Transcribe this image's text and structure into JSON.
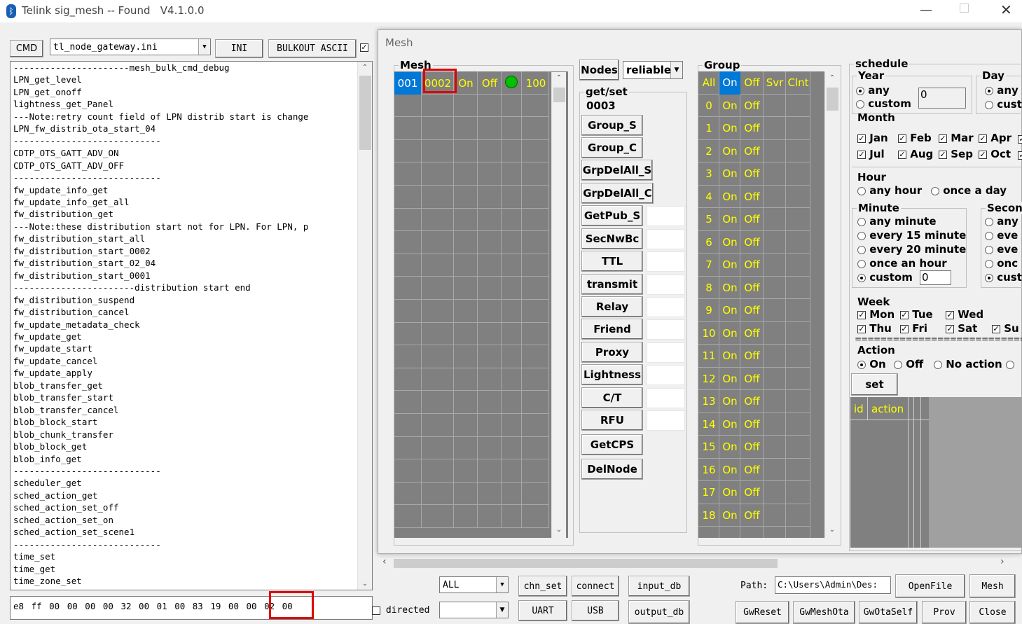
{
  "window": {
    "title": "Telink sig_mesh -- Found   V4.1.0.0"
  },
  "toolbar": {
    "cmd": "CMD",
    "ini_file": "tl_node_gateway.ini",
    "ini": "INI",
    "bulkout": "BULKOUT ASCII"
  },
  "cmd_list": [
    "----------------------mesh_bulk_cmd_debug",
    "LPN_get_level",
    "LPN_get_onoff",
    "lightness_get_Panel",
    "---Note:retry count field of LPN distrib start is change",
    "LPN_fw_distrib_ota_start_04",
    "----------------------------",
    "CDTP_OTS_GATT_ADV_ON",
    "CDTP_OTS_GATT_ADV_OFF",
    "----------------------------",
    "fw_update_info_get",
    "fw_update_info_get_all",
    "fw_distribution_get",
    "---Note:these distribution start not for LPN. For LPN, p",
    "fw_distribution_start_all",
    "fw_distribution_start_0002",
    "fw_distribution_start_02_04",
    "fw_distribution_start_0001",
    "-----------------------distribution start end",
    "fw_distribution_suspend",
    "fw_distribution_cancel",
    "fw_update_metadata_check",
    "fw_update_get",
    "fw_update_start",
    "fw_update_cancel",
    "fw_update_apply",
    "blob_transfer_get",
    "blob_transfer_start",
    "blob_transfer_cancel",
    "blob_block_start",
    "blob_chunk_transfer",
    "blob_block_get",
    "blob_info_get",
    "----------------------------",
    "scheduler_get",
    "sched_action_get",
    "sched_action_set_off",
    "sched_action_set_on",
    "sched_action_set_scene1",
    "----------------------------",
    "time_set",
    "time_get",
    "time_zone_set"
  ],
  "cmd_input": {
    "value": "e8 ff 00 00 00 00 32 00 01 00 83 19 00 00 02 00"
  },
  "bottom": {
    "all": "ALL",
    "directed": "directed",
    "chn_set": "chn_set",
    "connect": "connect",
    "input_db": "input_db",
    "uart": "UART",
    "usb": "USB",
    "output_db": "output_db",
    "path_label": "Path:",
    "path_value": "C:\\Users\\Admin\\Des:",
    "openfile": "OpenFile",
    "mesh": "Mesh",
    "gwreset": "GwReset",
    "gwmeshota": "GwMeshOta",
    "gwotaself": "GwOtaSelf",
    "prov": "Prov",
    "close": "Close"
  },
  "mesh_dialog": {
    "title": "Mesh",
    "mesh_label": "Mesh",
    "node": {
      "index": "001",
      "addr": "0002",
      "on": "On",
      "off": "Off",
      "level": "100",
      "status_color": "#00c000"
    },
    "nodes_label": "Nodes",
    "nodes_mode": "reliable",
    "getset_label": "get/set",
    "getset_addr": "0003",
    "buttons": [
      "Group_S",
      "Group_C",
      "GrpDelAll_S",
      "GrpDelAll_C",
      "GetPub_S",
      "SecNwBc",
      "TTL",
      "transmit",
      "Relay",
      "Friend",
      "Proxy",
      "Lightness",
      "C/T",
      "RFU",
      "GetCPS",
      "DelNode"
    ],
    "group_label": "Group",
    "group_header": [
      "All",
      "On",
      "Off",
      "Svr",
      "Clnt"
    ],
    "group_rows": [
      "0",
      "1",
      "2",
      "3",
      "4",
      "5",
      "6",
      "7",
      "8",
      "9",
      "10",
      "11",
      "12",
      "13",
      "14",
      "15",
      "16",
      "17",
      "18"
    ],
    "on": "On",
    "off": "Off",
    "schedule": {
      "title": "schedule",
      "year": "Year",
      "any": "any",
      "custom": "custom",
      "year_value": "0",
      "day": "Day",
      "day_any": "any",
      "day_custom": "cust",
      "month": "Month",
      "months": [
        "Jan",
        "Feb",
        "Mar",
        "Apr",
        "Jul",
        "Aug",
        "Sep",
        "Oct"
      ],
      "hour": "Hour",
      "any_hour": "any hour",
      "once_a_day": "once a day",
      "minute": "Minute",
      "any_minute": "any minute",
      "every15": "every 15 minute",
      "every20": "every 20 minute",
      "once_hour": "once an hour",
      "minute_custom": "custom",
      "minute_value": "0",
      "second": "Secon",
      "sec_opts": [
        "any",
        "eve",
        "eve",
        "onc",
        "cust"
      ],
      "week": "Week",
      "days": [
        "Mon",
        "Tue",
        "Wed",
        "Thu",
        "Fri",
        "Sat",
        "Su"
      ],
      "separator": "===========================================",
      "action": "Action",
      "act_on": "On",
      "act_off": "Off",
      "no_action": "No action",
      "set": "set",
      "col_id": "id",
      "col_action": "action"
    }
  }
}
